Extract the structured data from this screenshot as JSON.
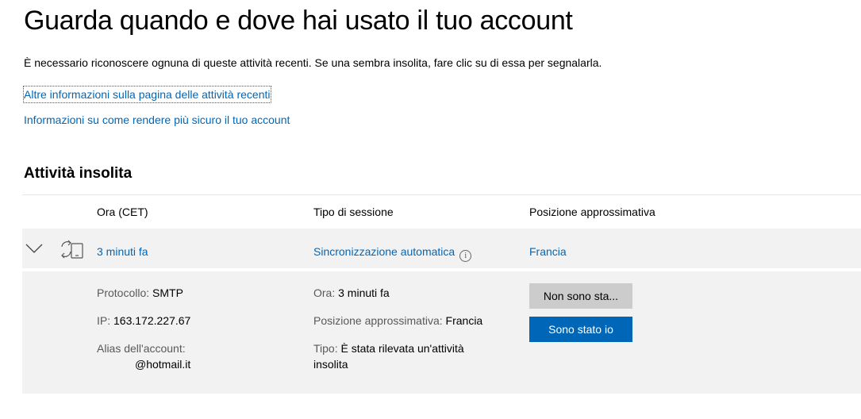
{
  "page": {
    "title": "Guarda quando e dove hai usato il tuo account",
    "intro": "È necessario riconoscere ognuna di queste attività recenti. Se una sembra insolita, fare clic su di essa per segnalarla.",
    "links": [
      "Altre informazioni sulla pagina delle attività recenti",
      "Informazioni su come rendere più sicuro il tuo account"
    ]
  },
  "section": {
    "title": "Attività insolita",
    "columns": [
      "Ora (CET)",
      "Tipo di sessione",
      "Posizione approssimativa"
    ]
  },
  "activity": {
    "icon": "sync-device-icon",
    "time": "3 minuti fa",
    "session_type": "Sincronizzazione automatica",
    "info_icon": "i",
    "location": "Francia",
    "details": {
      "protocol_label": "Protocollo:",
      "protocol_value": "SMTP",
      "ip_label": "IP:",
      "ip_value": "163.172.227.67",
      "alias_label": "Alias dell'account:",
      "alias_value": "@hotmail.it",
      "time_label": "Ora:",
      "time_value": "3 minuti fa",
      "location_label": "Posizione approssimativa:",
      "location_value": "Francia",
      "type_label": "Tipo:",
      "type_value_line1": "È stata rilevata un'attività",
      "type_value_line2": "insolita"
    },
    "buttons": {
      "not_me": "Non sono sta...",
      "was_me": "Sono stato io"
    }
  },
  "colors": {
    "link": "#0067b8",
    "primary_button": "#0067b8",
    "secondary_button": "#cccccc",
    "row_background": "#f2f2f2"
  }
}
